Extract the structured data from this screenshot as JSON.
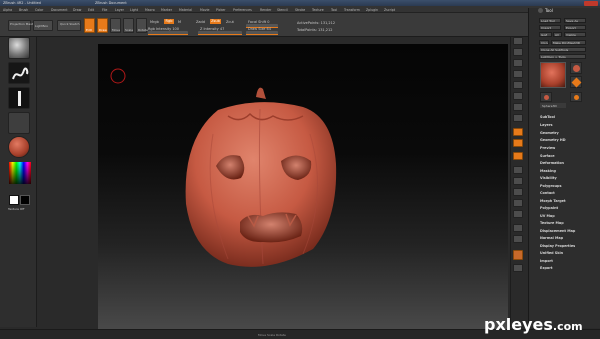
{
  "window": {
    "title": "ZBrush 4R2 - Untitled",
    "document_label": "ZBrush Document"
  },
  "menu": [
    "Alpha",
    "Brush",
    "Color",
    "Document",
    "Draw",
    "Edit",
    "File",
    "Layer",
    "Light",
    "Macro",
    "Marker",
    "Material",
    "Movie",
    "Picker",
    "Preferences",
    "Render",
    "Stencil",
    "Stroke",
    "Texture",
    "Tool",
    "Transform",
    "Zplugin",
    "Zscript"
  ],
  "toolbar": {
    "projection_label": "Projection Master",
    "lightbox_label": "LightBox",
    "quick_sketch_label": "Quick Sketch",
    "edit_label": "Edit",
    "draw_label": "Draw",
    "move_label": "Move",
    "scale_label": "Scale",
    "rotate_label": "Rotate",
    "mrgb_label": "Mrgb",
    "rgb_label": "Rgb",
    "m_label": "M",
    "zadd_label": "Zadd",
    "zsub_label": "Zsub",
    "zcut_label": "Zcut",
    "rgb_intensity_label": "Rgb Intensity 100",
    "z_intensity_label": "Z Intensity 47",
    "focal_shift_label": "Focal Shift 0",
    "draw_size_label": "Draw Size 64",
    "active_points_label": "ActivePoints: 131,212",
    "total_points_label": "TotalPoints: 131,212"
  },
  "left_panel": {
    "texture_off_label": "Texture Off"
  },
  "right_panel": {
    "header": "Tool",
    "load_tool": "Load Tool",
    "save_as": "Save As",
    "import": "Import",
    "export": "Export",
    "goz": "GoZ",
    "all": "All",
    "visible": "Visible",
    "clone": "Clone",
    "make_polymesh": "Make PolyMesh3D",
    "clone_all_subtools": "Clone All SubTools",
    "lightbox_tools": "Lightbox > Tools",
    "tool_name": "Sphere3D",
    "menu_items": [
      "SubTool",
      "Layers",
      "Geometry",
      "Geometry HD",
      "Preview",
      "Surface",
      "Deformation",
      "Masking",
      "Visibility",
      "Polygroups",
      "Contact",
      "Morph Target",
      "Polypaint",
      "UV Map",
      "Texture Map",
      "Displacement Map",
      "Normal Map",
      "Display Properties",
      "Unified Skin",
      "Import",
      "Export"
    ]
  },
  "status": {
    "text": "Move Scale Rotate"
  },
  "watermark": {
    "brand": "pxleyes",
    "tld": ".com"
  },
  "colors": {
    "accent": "#e77a1a",
    "model": "#c65a43",
    "canvas_top": "#050505",
    "canvas_bottom": "#4a4a4a"
  }
}
